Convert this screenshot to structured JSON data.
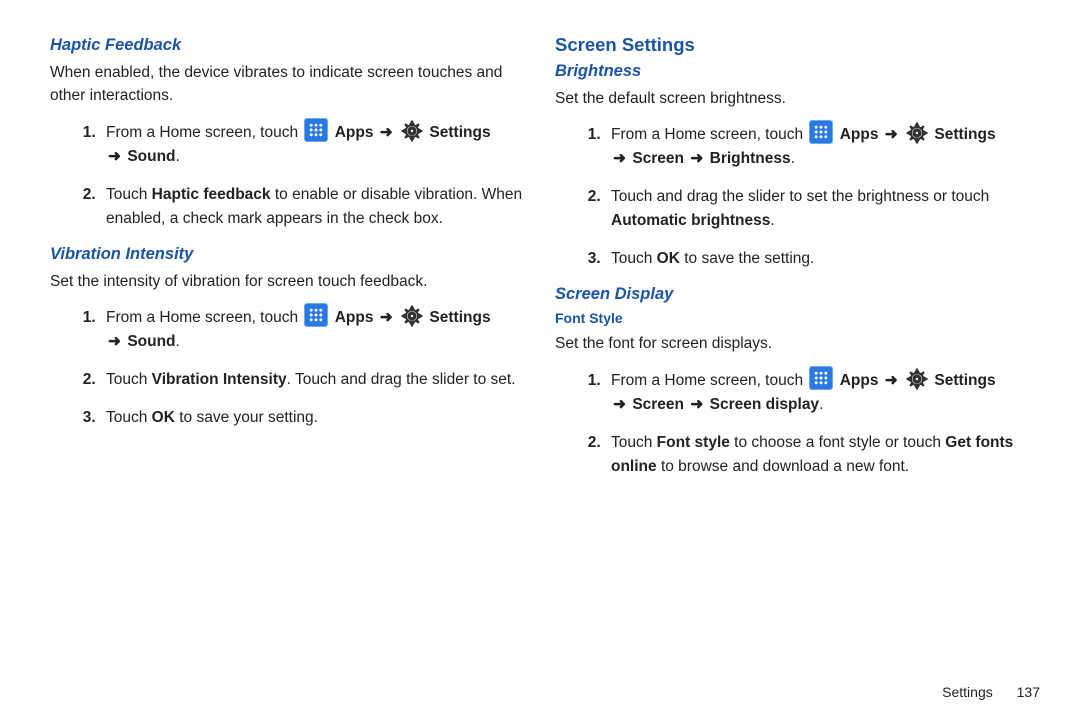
{
  "left": {
    "haptic": {
      "heading": "Haptic Feedback",
      "intro": "When enabled, the device vibrates to indicate screen touches and other interactions.",
      "step1_pre": "From a Home screen, touch ",
      "apps": "Apps",
      "settings": "Settings",
      "step1_tail": "Sound",
      "step2a": "Touch ",
      "step2b": "Haptic feedback",
      "step2c": " to enable or disable vibration. When enabled, a check mark appears in the check box."
    },
    "vib": {
      "heading": "Vibration Intensity",
      "intro": "Set the intensity of vibration for screen touch feedback.",
      "step1_pre": "From a Home screen, touch ",
      "apps": "Apps",
      "settings": "Settings",
      "step1_tail": "Sound",
      "step2a": "Touch ",
      "step2b": "Vibration Intensity",
      "step2c": ". Touch and drag the slider to set.",
      "step3a": "Touch ",
      "step3b": "OK",
      "step3c": " to save your setting."
    }
  },
  "right": {
    "screen_settings": "Screen Settings",
    "brightness": {
      "heading": "Brightness",
      "intro": "Set the default screen brightness.",
      "step1_pre": "From a Home screen, touch ",
      "apps": "Apps",
      "settings": "Settings",
      "step1_mid": "Screen",
      "step1_tail": "Brightness",
      "step2a": "Touch and drag the slider to set the brightness or touch ",
      "step2b": "Automatic brightness",
      "step3a": "Touch ",
      "step3b": "OK",
      "step3c": " to save the setting."
    },
    "display": {
      "heading": "Screen Display",
      "font_heading": "Font Style",
      "intro": "Set the font for screen displays.",
      "step1_pre": "From a Home screen, touch ",
      "apps": "Apps",
      "settings": "Settings",
      "step1_mid": "Screen",
      "step1_tail": "Screen display",
      "step2a": "Touch ",
      "step2b": "Font style",
      "step2c": " to choose a font style or touch ",
      "step2d": "Get fonts online",
      "step2e": " to browse and download a new font."
    }
  },
  "footer": {
    "section": "Settings",
    "page": "137"
  },
  "arrow": "➜",
  "period": "."
}
